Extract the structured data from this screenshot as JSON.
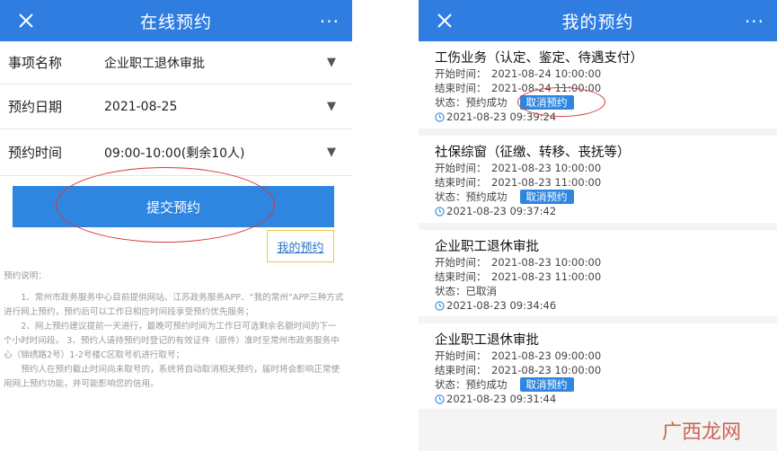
{
  "left": {
    "nav_title": "在线预约",
    "more_label": "···",
    "form": [
      {
        "label": "事项名称",
        "value": "企业职工退休审批"
      },
      {
        "label": "预约日期",
        "value": "2021-08-25"
      },
      {
        "label": "预约时间",
        "value": "09:00-10:00(剩余10人)"
      }
    ],
    "dropdown_glyph": "▼",
    "submit_label": "提交预约",
    "my_appointments_link": "我的预约",
    "notice_title": "预约说明：",
    "notice_p1": "1、常州市政务服务中心目前提供网站、江苏政务服务APP、“我的常州”APP三种方式进行网上预约，预约后可以工作日相应时间段享受预约优先服务；",
    "notice_p2": "2、网上预约建议提前一天进行，最晚可预约时间为工作日可选剩余名额时间的下一个小时时间段。 3、预约人请持预约时登记的有效证件（原件）准时至常州市政务服务中心（锦绣路2号）1-2号楼C区取号机进行取号；",
    "notice_p3": "预约人在预约截止时间尚未取号的，系统将自动取消相关预约，届时将会影响正常使用网上预约功能，并可能影响您的信用。"
  },
  "right": {
    "nav_title": "我的预约",
    "more_label": "···",
    "labels": {
      "start": "开始时间：",
      "end": "结束时间：",
      "status": "状态："
    },
    "cancel_label": "取消预约",
    "appointments": [
      {
        "title": "工伤业务（认定、鉴定、待遇支付）",
        "start": "2021-08-24 10:00:00",
        "end": "2021-08-24 11:00:00",
        "status": "预约成功",
        "stamp": "2021-08-23 09:39:24"
      },
      {
        "title": "社保综窗（征缴、转移、丧抚等）",
        "start": "2021-08-23 10:00:00",
        "end": "2021-08-23 11:00:00",
        "status": "预约成功",
        "stamp": "2021-08-23 09:37:42"
      },
      {
        "title": "企业职工退休审批",
        "start": "2021-08-23 10:00:00",
        "end": "2021-08-23 11:00:00",
        "status": "已取消",
        "stamp": "2021-08-23 09:34:46"
      },
      {
        "title": "企业职工退休审批",
        "start": "2021-08-23 09:00:00",
        "end": "2021-08-23 10:00:00",
        "status": "预约成功",
        "stamp": "2021-08-23 09:31:44"
      }
    ]
  },
  "watermark": "广西龙网",
  "colors": {
    "nav_blue": "#2f7de1",
    "button_blue": "#2f86e0",
    "annotation_red": "#d9383a",
    "highlight_yellow": "#e6c84a"
  },
  "icons": {
    "close": "close-icon",
    "more": "more-icon",
    "dropdown": "dropdown-icon",
    "clock": "clock-icon"
  }
}
